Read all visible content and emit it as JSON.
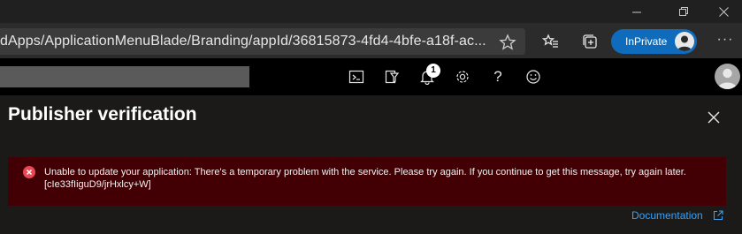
{
  "browser": {
    "address_url": "dApps/ApplicationMenuBlade/Branding/appId/36815873-4fd4-4bfe-a18f-ac...",
    "inprivate_label": "InPrivate",
    "more_label": "···"
  },
  "window_controls": {
    "minimize": "minimize-icon",
    "restore": "restore-icon",
    "close": "close-icon"
  },
  "portal_header": {
    "icons": [
      "cloud-shell-icon",
      "directory-filter-icon",
      "notifications-icon",
      "settings-icon",
      "help-icon",
      "feedback-icon"
    ],
    "notification_count": "1"
  },
  "blade": {
    "title": "Publisher verification",
    "error_message": "Unable to update your application: There's a temporary problem with the service. Please try again. If you continue to get this message, try again later. [cIe33fIiguD9/jrHxlcy+W]",
    "documentation_link": "Documentation"
  },
  "colors": {
    "accent": "#0f6cbd",
    "error_bg": "#420005",
    "error_icon": "#e74856",
    "link": "#3aa0f3"
  }
}
